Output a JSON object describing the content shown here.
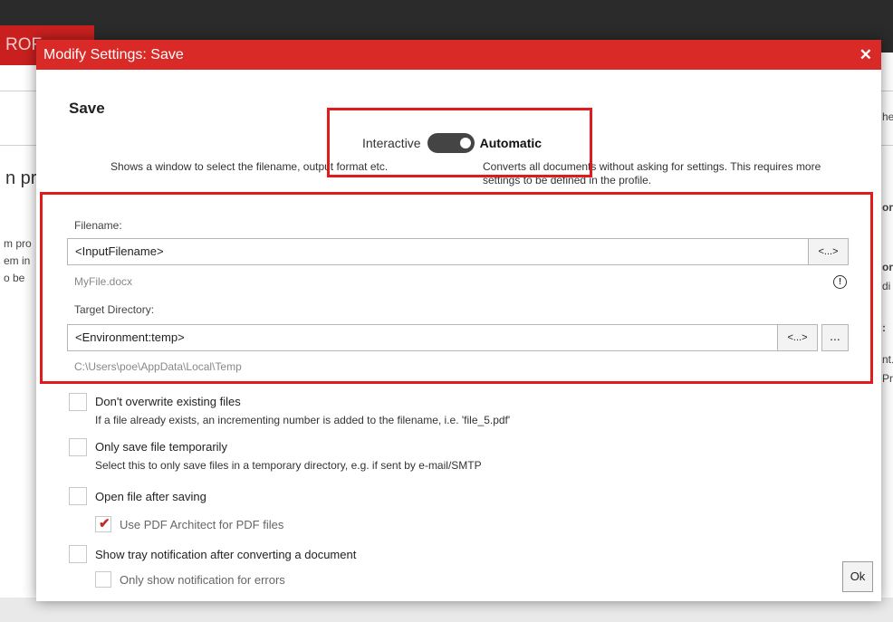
{
  "background": {
    "brand_text": "ROF",
    "fragments": [
      "n pr",
      "m pro",
      "em in",
      "o be",
      "he",
      "or",
      "or",
      "di",
      ":",
      "nt.",
      "Pr"
    ]
  },
  "dialog": {
    "title": "Modify Settings: Save",
    "close_icon": "close-icon",
    "heading": "Save",
    "mode": {
      "interactive_label": "Interactive",
      "automatic_label": "Automatic",
      "selected": "Automatic",
      "interactive_desc": "Shows a window to select the filename, output format etc.",
      "automatic_desc": "Converts all documents without asking for settings. This requires more settings to be defined in the profile."
    },
    "filename": {
      "label": "Filename:",
      "value": "<InputFilename>",
      "token_button": "<...>",
      "preview": "MyFile.docx",
      "warning_icon": "warning-icon"
    },
    "target_directory": {
      "label": "Target Directory:",
      "value": "<Environment:temp>",
      "token_button": "<...>",
      "browse_button": "...",
      "preview": "C:\\Users\\poe\\AppData\\Local\\Temp"
    },
    "options": [
      {
        "label": "Don't overwrite existing files",
        "desc": "If a file already exists, an incrementing number is added to the filename, i.e. 'file_5.pdf'",
        "checked": false
      },
      {
        "label": "Only save file temporarily",
        "desc": "Select this to only save files in a temporary directory, e.g. if sent by e-mail/SMTP",
        "checked": false
      },
      {
        "label": "Open file after saving",
        "checked": false
      },
      {
        "label": "Use PDF Architect for PDF files",
        "checked": true,
        "enabled": false
      },
      {
        "label": "Show tray notification after converting a document",
        "checked": false
      },
      {
        "label": "Only show notification for errors",
        "checked": false,
        "enabled": false
      }
    ],
    "ok_button": "Ok"
  },
  "colors": {
    "accent": "#d92a27",
    "annotation": "#e11b1b",
    "checkmark": "#c42a2a"
  }
}
